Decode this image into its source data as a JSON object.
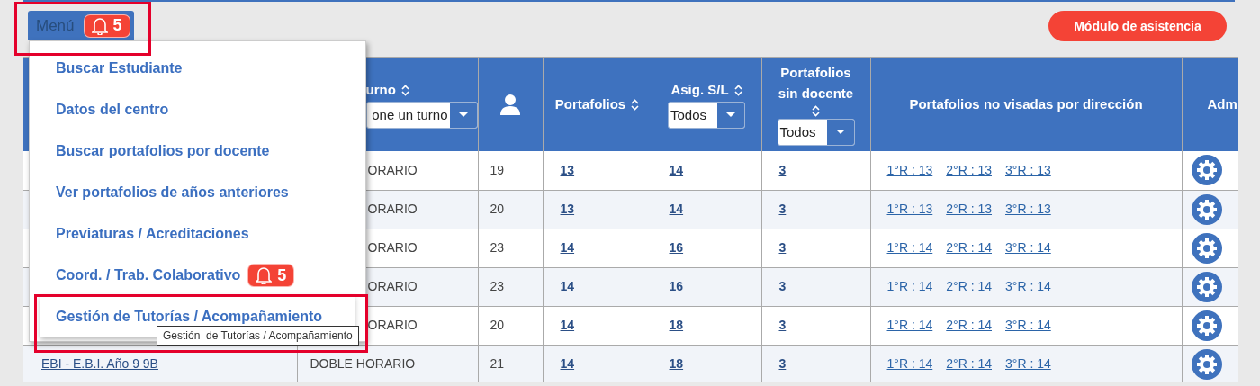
{
  "menu_button": {
    "label": "Menú",
    "badge": "5"
  },
  "attendance_button": "Módulo de asistencia",
  "menu": {
    "items": [
      {
        "label": "Buscar Estudiante",
        "highlighted": false
      },
      {
        "label": "Datos del centro",
        "highlighted": false
      },
      {
        "label": "Buscar portafolios por docente",
        "highlighted": false
      },
      {
        "label": "Ver portafolios de años anteriores",
        "highlighted": false
      },
      {
        "label": "Previaturas / Acreditaciones",
        "highlighted": false
      },
      {
        "label": "Coord. / Trab. Colaborativo",
        "badge": "5",
        "highlighted": false
      },
      {
        "label": "Gestión de Tutorías / Acompañamiento",
        "highlighted": true
      }
    ]
  },
  "tooltip": "Gestión  de Tutorías / Acompañamiento",
  "table": {
    "columns": [
      {
        "kind": "text",
        "label": "urno",
        "sortable": true,
        "filter": "one un turno"
      },
      {
        "kind": "icon"
      },
      {
        "kind": "text",
        "label": "Portafolios",
        "sortable": true
      },
      {
        "kind": "text",
        "label": "Asig. S/L",
        "sortable": true,
        "filter": "Todos"
      },
      {
        "kind": "text",
        "label": "Portafolios sin docente",
        "sortable": true,
        "filter": "Todos"
      },
      {
        "kind": "text",
        "label": "Portafolios no visadas por dirección"
      },
      {
        "kind": "text",
        "label": "Adm"
      }
    ],
    "rows": [
      {
        "turno": "ORARIO",
        "students": "19",
        "portafolios": "13",
        "asig": "14",
        "sin_docente": "3",
        "no_visadas": [
          "1°R : 13",
          "2°R : 13",
          "3°R : 13"
        ]
      },
      {
        "turno": "ORARIO",
        "students": "20",
        "portafolios": "13",
        "asig": "14",
        "sin_docente": "3",
        "no_visadas": [
          "1°R : 13",
          "2°R : 13",
          "3°R : 13"
        ]
      },
      {
        "turno": "ORARIO",
        "students": "23",
        "portafolios": "14",
        "asig": "16",
        "sin_docente": "3",
        "no_visadas": [
          "1°R : 14",
          "2°R : 14",
          "3°R : 14"
        ]
      },
      {
        "turno": "ORARIO",
        "students": "23",
        "portafolios": "14",
        "asig": "16",
        "sin_docente": "3",
        "no_visadas": [
          "1°R : 14",
          "2°R : 14",
          "3°R : 14"
        ]
      },
      {
        "turno": "ORARIO",
        "students": "20",
        "portafolios": "14",
        "asig": "18",
        "sin_docente": "3",
        "no_visadas": [
          "1°R : 14",
          "2°R : 14",
          "3°R : 14"
        ]
      },
      {
        "grupo": "EBI - E.B.I. Año 9 9B",
        "turno": "DOBLE HORARIO",
        "students": "21",
        "portafolios": "14",
        "asig": "18",
        "sin_docente": "3",
        "no_visadas": [
          "1°R : 14",
          "2°R : 14",
          "3°R : 14"
        ]
      }
    ]
  }
}
